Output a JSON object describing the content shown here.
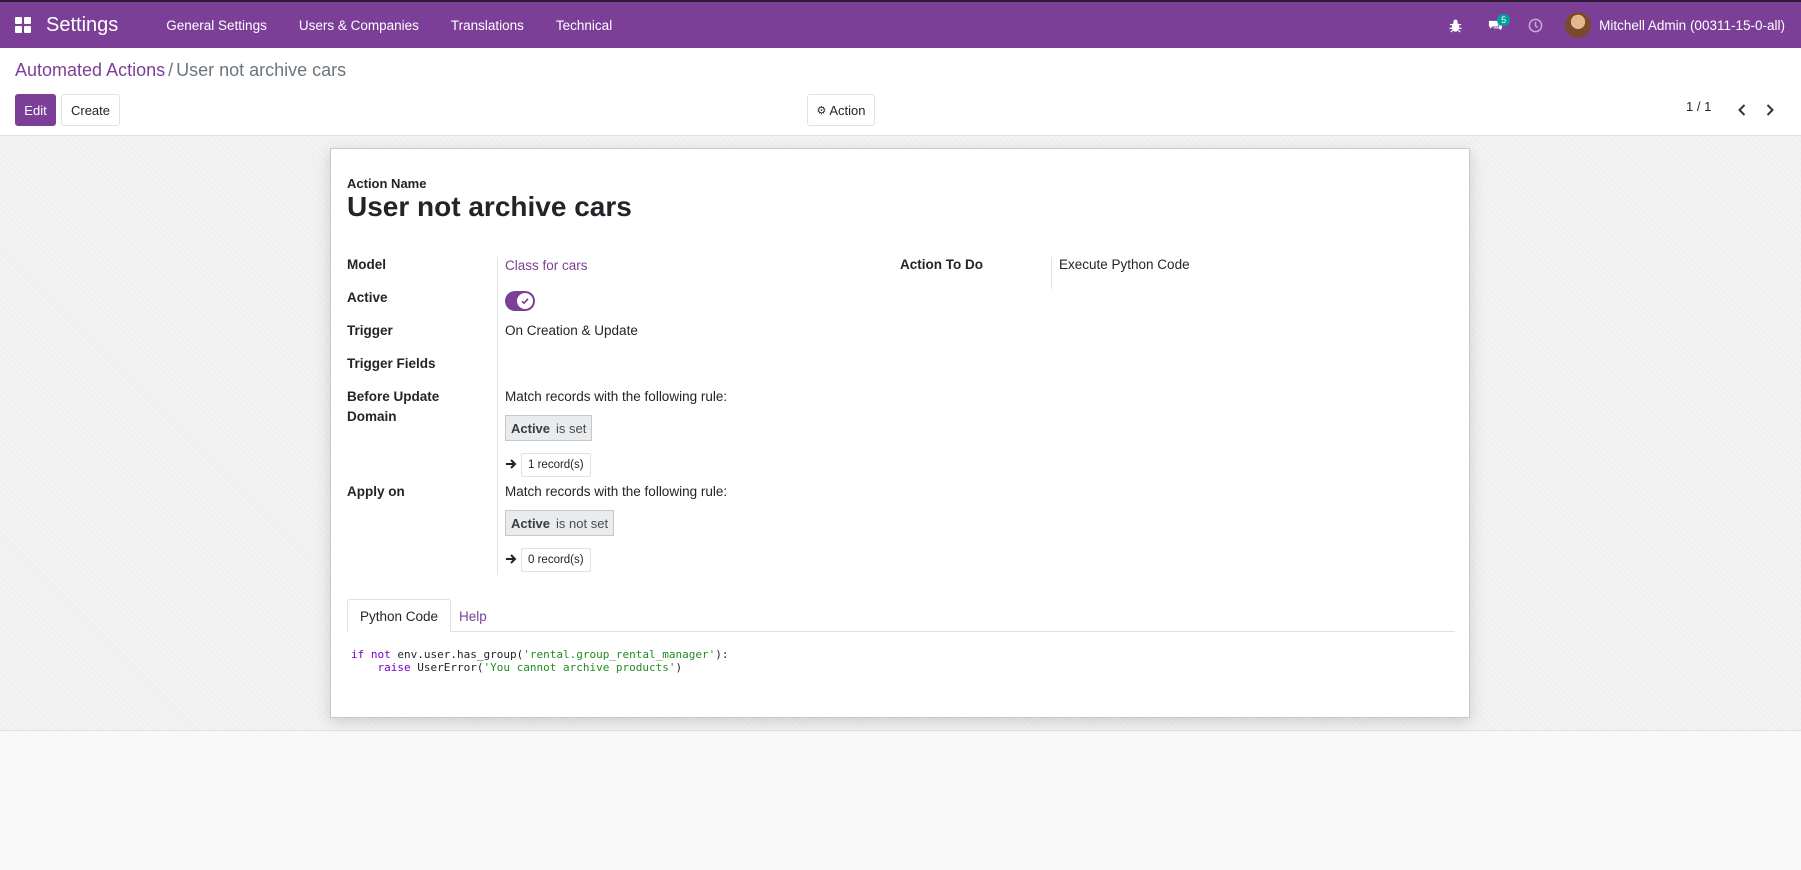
{
  "navbar": {
    "app_title": "Settings",
    "menu": [
      "General Settings",
      "Users & Companies",
      "Translations",
      "Technical"
    ],
    "messages_count": "5",
    "user_name": "Mitchell Admin (00311-15-0-all)"
  },
  "control_panel": {
    "breadcrumb_parent": "Automated Actions",
    "breadcrumb_separator": "/",
    "breadcrumb_current": "User not archive cars",
    "edit_label": "Edit",
    "create_label": "Create",
    "action_label": "Action",
    "pager": "1 / 1"
  },
  "form": {
    "action_name_label": "Action Name",
    "action_name": "User not archive cars",
    "model_label": "Model",
    "model_value": "Class for cars",
    "action_to_do_label": "Action To Do",
    "action_to_do_value": "Execute Python Code",
    "active_label": "Active",
    "active_value": true,
    "trigger_label": "Trigger",
    "trigger_value": "On Creation & Update",
    "trigger_fields_label": "Trigger Fields",
    "before_update_domain_label_1": "Before Update",
    "before_update_domain_label_2": "Domain",
    "before_update_rule_text": "Match records with the following rule:",
    "before_update_chip_field": "Active",
    "before_update_chip_op": "is set",
    "before_update_records": "1 record(s)",
    "apply_on_label": "Apply on",
    "apply_on_rule_text": "Match records with the following rule:",
    "apply_on_chip_field": "Active",
    "apply_on_chip_op": "is not set",
    "apply_on_records": "0 record(s)"
  },
  "tabs": {
    "python_code": "Python Code",
    "help": "Help"
  },
  "code": {
    "line1_kw1": "if",
    "line1_kw2": "not",
    "line1_call": "env.user.has_group(",
    "line1_str": "'rental.group_rental_manager'",
    "line1_end": "):",
    "line2_kw": "raise",
    "line2_call": "UserError(",
    "line2_str": "'You cannot archive products'",
    "line2_end": ")"
  },
  "colors": {
    "brand": "#7c3f98",
    "badge": "#00a09d"
  }
}
